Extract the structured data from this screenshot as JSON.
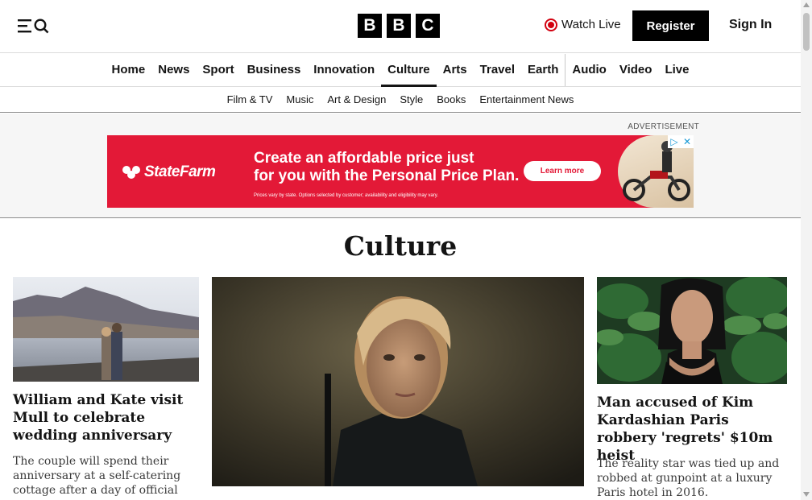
{
  "header": {
    "logo_letters": [
      "B",
      "B",
      "C"
    ],
    "watch_live_label": "Watch Live",
    "register_label": "Register",
    "signin_label": "Sign In"
  },
  "primary_nav": {
    "items": [
      {
        "label": "Home"
      },
      {
        "label": "News"
      },
      {
        "label": "Sport"
      },
      {
        "label": "Business"
      },
      {
        "label": "Innovation"
      },
      {
        "label": "Culture",
        "active": true
      },
      {
        "label": "Arts"
      },
      {
        "label": "Travel"
      },
      {
        "label": "Earth"
      },
      {
        "label": "Audio"
      },
      {
        "label": "Video"
      },
      {
        "label": "Live"
      }
    ]
  },
  "sub_nav": {
    "items": [
      "Film & TV",
      "Music",
      "Art & Design",
      "Style",
      "Books",
      "Entertainment News"
    ]
  },
  "advertisement": {
    "label": "ADVERTISEMENT",
    "brand": "StateFarm",
    "headline_line1": "Create an affordable price just",
    "headline_line2": "for you with the Personal Price Plan.",
    "fine_print": "Prices vary by state. Options selected by customer; availability and eligibility may vary.",
    "cta_label": "Learn more",
    "brand_color": "#e31937"
  },
  "section": {
    "title": "Culture"
  },
  "articles": [
    {
      "headline": "William and Kate visit Mull to celebrate wedding anniversary",
      "summary": "The couple will spend their anniversary at a self-catering cottage after a day of official"
    },
    {
      "headline": "Man accused of Kim Kardashian Paris robbery 'regrets' $10m heist",
      "summary": "The reality star was tied up and robbed at gunpoint at a luxury Paris hotel in 2016."
    }
  ]
}
